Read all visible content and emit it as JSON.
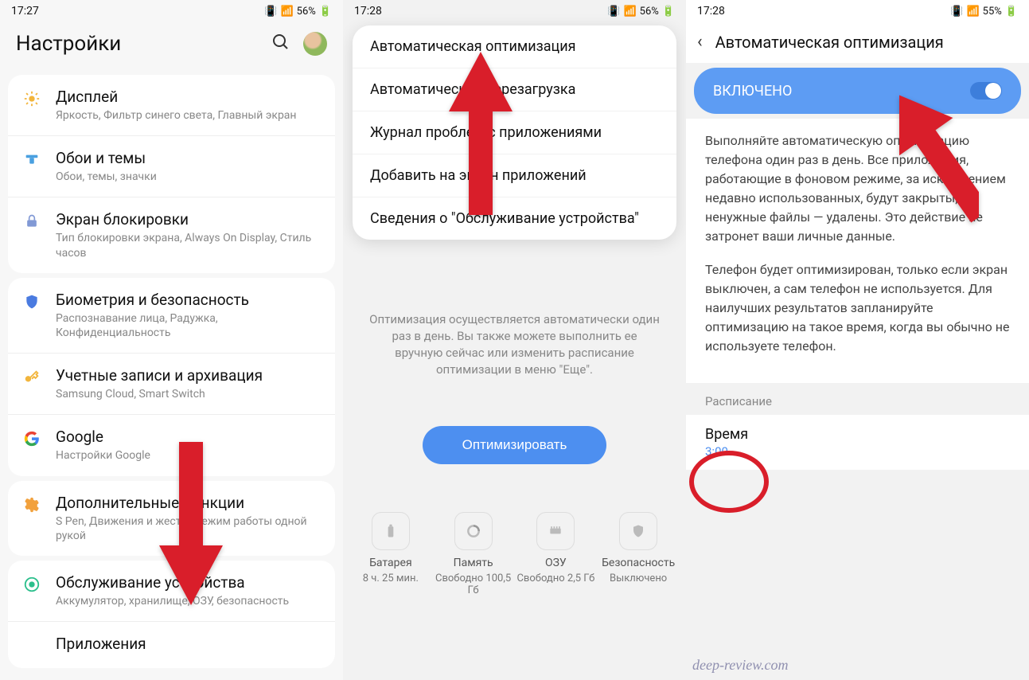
{
  "phone1": {
    "statusbar": {
      "time": "17:27",
      "battery": "56%"
    },
    "header": "Настройки",
    "groups": [
      [
        {
          "icon": "display",
          "title": "Дисплей",
          "sub": "Яркость, Фильтр синего света, Главный экран"
        },
        {
          "icon": "wallpaper",
          "title": "Обои и темы",
          "sub": "Обои, темы, значки"
        },
        {
          "icon": "lock",
          "title": "Экран блокировки",
          "sub": "Тип блокировки экрана, Always On Display, Стиль часов"
        }
      ],
      [
        {
          "icon": "shield",
          "title": "Биометрия и безопасность",
          "sub": "Распознавание лица, Радужка, Конфиденциальность"
        },
        {
          "icon": "key",
          "title": "Учетные записи и архивация",
          "sub": "Samsung Cloud, Smart Switch"
        },
        {
          "icon": "google",
          "title": "Google",
          "sub": "Настройки Google"
        }
      ],
      [
        {
          "icon": "gear",
          "title": "Дополнительные функции",
          "sub": "S Pen, Движения и жесты, Режим работы одной рукой"
        }
      ],
      [
        {
          "icon": "device",
          "title": "Обслуживание устройства",
          "sub": "Аккумулятор, хранилище, ОЗУ, безопасность"
        },
        {
          "icon": "apps",
          "title": "Приложения",
          "sub": ""
        }
      ]
    ]
  },
  "phone2": {
    "statusbar": {
      "time": "17:28",
      "battery": "56%"
    },
    "menu": [
      "Автоматическая оптимизация",
      "Автоматическая перезагрузка",
      "Журнал проблем с приложениями",
      "Добавить на экран приложений",
      "Сведения о \"Обслуживание устройства\""
    ],
    "info": "Оптимизация осуществляется автоматически один раз в день. Вы также можете выполнить ее вручную сейчас или изменить расписание оптимизации в меню \"Еще\".",
    "optimize_button": "Оптимизировать",
    "stats": [
      {
        "label": "Батарея",
        "value": "8 ч. 25 мин."
      },
      {
        "label": "Память",
        "value": "Свободно 100,5 Гб"
      },
      {
        "label": "ОЗУ",
        "value": "Свободно 2,5 Гб"
      },
      {
        "label": "Безопасность",
        "value": "Выключено"
      }
    ]
  },
  "phone3": {
    "statusbar": {
      "time": "17:28",
      "battery": "55%"
    },
    "title": "Автоматическая оптимизация",
    "toggle_label": "ВКЛЮЧЕНО",
    "toggle_state": true,
    "para1": "Выполняйте автоматическую оптимизацию телефона один раз в день. Все приложения, работающие в фоновом режиме, за исключением недавно использованных, будут закрыты, а ненужные файлы — удалены. Это действие не затронет ваши личные данные.",
    "para2": "Телефон будет оптимизирован, только если экран выключен, а сам телефон не используется. Для наилучших результатов запланируйте оптимизацию на такое время, когда вы обычно не используете телефон.",
    "schedule_label": "Расписание",
    "time_label": "Время",
    "time_value": "3:00"
  },
  "watermark": "deep-review.com",
  "colors": {
    "accent": "#4d8ff0",
    "annotation": "#d91e2a"
  }
}
